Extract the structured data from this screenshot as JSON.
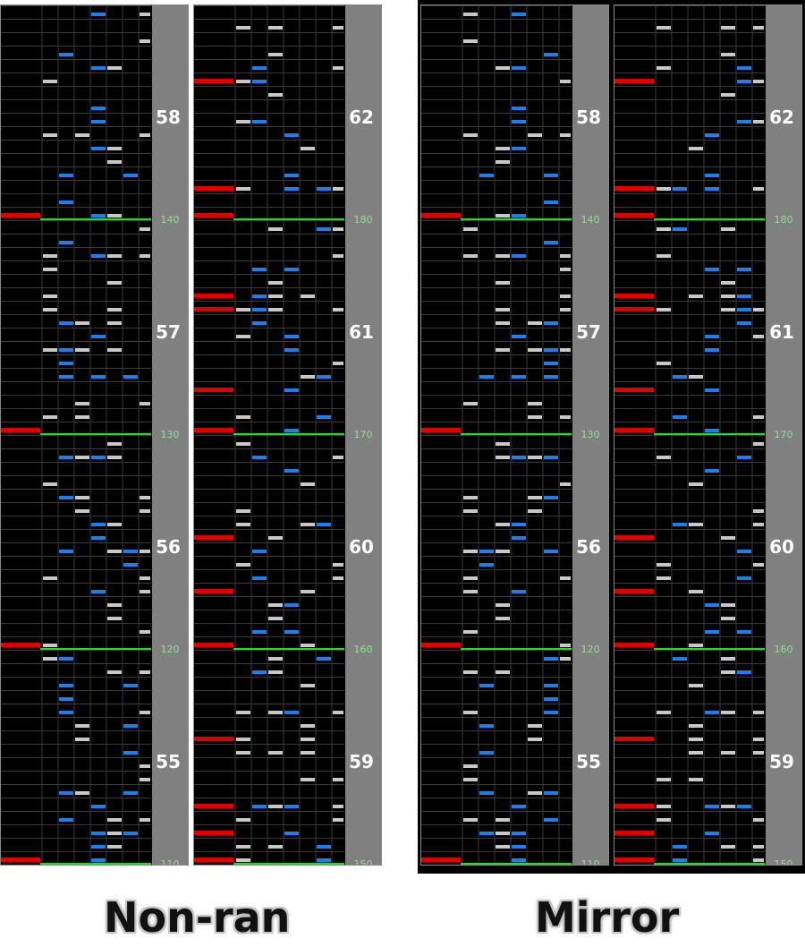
{
  "captions": {
    "nonran": "Non-ran",
    "mirror": "Mirror"
  },
  "colors": {
    "background": "#000000",
    "gutter": "#808080",
    "gridline": "#3a3a3a",
    "measure_line": "#22dd22",
    "scratch_note": "#e00000",
    "white_key_note": "#c8c8c8",
    "blue_key_note": "#1a80f0",
    "bpm_text": "#8fe08f"
  },
  "panels": [
    {
      "id": "nonran-a",
      "group": "nonran",
      "measures": [
        "58",
        "57",
        "56",
        "55"
      ],
      "bpm_ticks": [
        "140",
        "130",
        "120",
        "110"
      ]
    },
    {
      "id": "nonran-b",
      "group": "nonran",
      "measures": [
        "62",
        "61",
        "60",
        "59"
      ],
      "bpm_ticks": [
        "180",
        "170",
        "160",
        "150"
      ]
    },
    {
      "id": "mirror-a",
      "group": "mirror",
      "measures": [
        "58",
        "57",
        "56",
        "55"
      ],
      "bpm_ticks": [
        "140",
        "130",
        "120",
        "110"
      ]
    },
    {
      "id": "mirror-b",
      "group": "mirror",
      "measures": [
        "62",
        "61",
        "60",
        "59"
      ],
      "bpm_ticks": [
        "180",
        "170",
        "160",
        "150"
      ]
    }
  ]
}
